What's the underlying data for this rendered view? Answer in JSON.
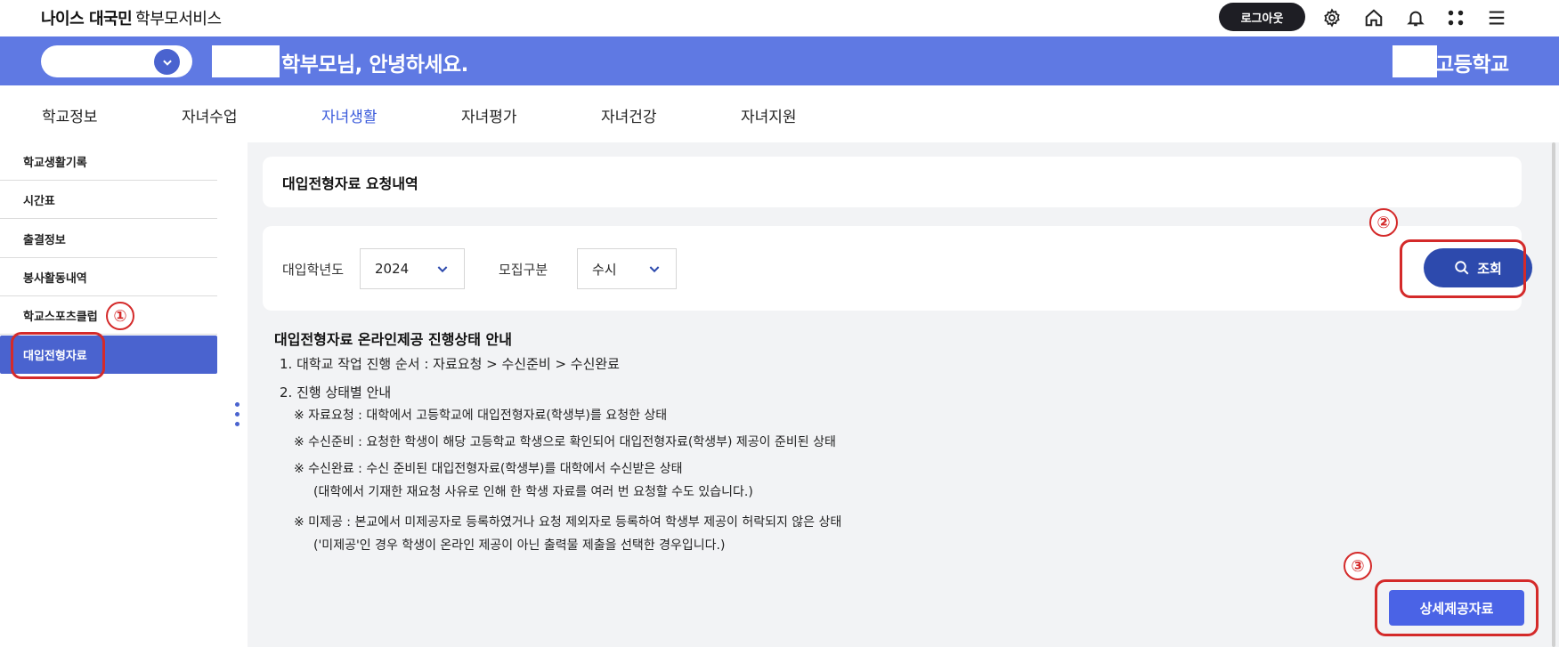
{
  "app": {
    "brand": "나이스 대국민",
    "service": "학부모서비스"
  },
  "topbar": {
    "logout_label": "로그아웃",
    "icons": [
      "gear-icon",
      "home-icon",
      "bell-icon",
      "apps-grid-icon",
      "menu-icon"
    ]
  },
  "banner": {
    "greeting": "학부모님, 안녕하세요.",
    "school_suffix": "고등학교",
    "background_color": "#5f79e3"
  },
  "nav": {
    "tabs": [
      {
        "label": "학교정보",
        "active": false
      },
      {
        "label": "자녀수업",
        "active": false
      },
      {
        "label": "자녀생활",
        "active": true
      },
      {
        "label": "자녀평가",
        "active": false
      },
      {
        "label": "자녀건강",
        "active": false
      },
      {
        "label": "자녀지원",
        "active": false
      }
    ]
  },
  "sidebar": {
    "items": [
      {
        "label": "학교생활기록",
        "active": false
      },
      {
        "label": "시간표",
        "active": false
      },
      {
        "label": "출결정보",
        "active": false
      },
      {
        "label": "봉사활동내역",
        "active": false
      },
      {
        "label": "학교스포츠클럽",
        "active": false
      },
      {
        "label": "대입전형자료",
        "active": true
      }
    ]
  },
  "page": {
    "title": "대입전형자료 요청내역",
    "filters": {
      "year_label": "대입학년도",
      "year_value": "2024",
      "type_label": "모집구분",
      "type_value": "수시"
    },
    "search_label": "조회",
    "guide": {
      "title": "대입전형자료 온라인제공 진행상태 안내",
      "step1": "1. 대학교 작업 진행 순서 : 자료요청 > 수신준비 > 수신완료",
      "step2": "2. 진행 상태별 안내",
      "note_request": "※ 자료요청 : 대학에서 고등학교에 대입전형자료(학생부)를 요청한 상태",
      "note_ready": "※ 수신준비 : 요청한 학생이 해당 고등학교 학생으로 확인되어 대입전형자료(학생부) 제공이 준비된 상태",
      "note_done": "※ 수신완료 : 수신 준비된 대입전형자료(학생부)를 대학에서 수신받은 상태",
      "note_done_sub": "(대학에서 기재한 재요청 사유로 인해 한 학생 자료를 여러 번 요청할 수도 있습니다.)",
      "note_none": "※ 미제공 : 본교에서 미제공자로 등록하였거나 요청 제외자로 등록하여 학생부 제공이 허락되지 않은 상태",
      "note_none_sub": "('미제공'인 경우 학생이 온라인 제공이 아닌 출력물 제출을 선택한 경우입니다.)"
    },
    "detail_button_label": "상세제공자료"
  },
  "annotations": {
    "markers": [
      "①",
      "②",
      "③"
    ],
    "color": "#d42a2a"
  },
  "colors": {
    "accent": "#4a63cf",
    "search_button": "#2d4aad",
    "detail_button": "#4a63e6"
  }
}
